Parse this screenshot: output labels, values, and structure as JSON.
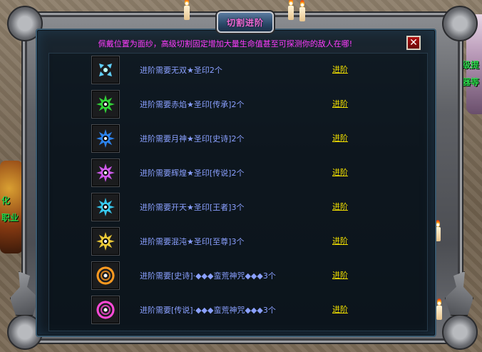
{
  "title": "切割进阶",
  "description": "佩戴位置为面纱，高级切割固定增加大量生命值甚至可探测你的敌人在哪!",
  "world": {
    "left_labels": [
      "化",
      "职业"
    ],
    "right_labels": [
      "等级提",
      "神器等"
    ]
  },
  "rows": [
    {
      "text": "进阶需要无双★圣印2个",
      "action": "进阶",
      "icon": "seal-wushuang-icon",
      "color": "#5fd0ff"
    },
    {
      "text": "进阶需要赤焰★圣印[传承]2个",
      "action": "进阶",
      "icon": "seal-chiyan-icon",
      "color": "#35e33a"
    },
    {
      "text": "进阶需要月神★圣印[史诗]2个",
      "action": "进阶",
      "icon": "seal-yueshen-icon",
      "color": "#2f8cff"
    },
    {
      "text": "进阶需要辉煌★圣印[传说]2个",
      "action": "进阶",
      "icon": "seal-huihuang-icon",
      "color": "#e060ff"
    },
    {
      "text": "进阶需要开天★圣印[王者]3个",
      "action": "进阶",
      "icon": "seal-kaitian-icon",
      "color": "#3ad6ff"
    },
    {
      "text": "进阶需要混沌★圣印[至尊]3个",
      "action": "进阶",
      "icon": "seal-hundun-icon",
      "color": "#ffd83a"
    },
    {
      "text": "进阶需要[史诗]·◆◆◆蛮荒神咒◆◆◆3个",
      "action": "进阶",
      "icon": "rune-ring-gold-icon",
      "color": "#ff9a20"
    },
    {
      "text": "进阶需要[传说]·◆◆◆蛮荒神咒◆◆◆3个",
      "action": "进阶",
      "icon": "rune-ring-pink-icon",
      "color": "#ff4ad8"
    }
  ]
}
